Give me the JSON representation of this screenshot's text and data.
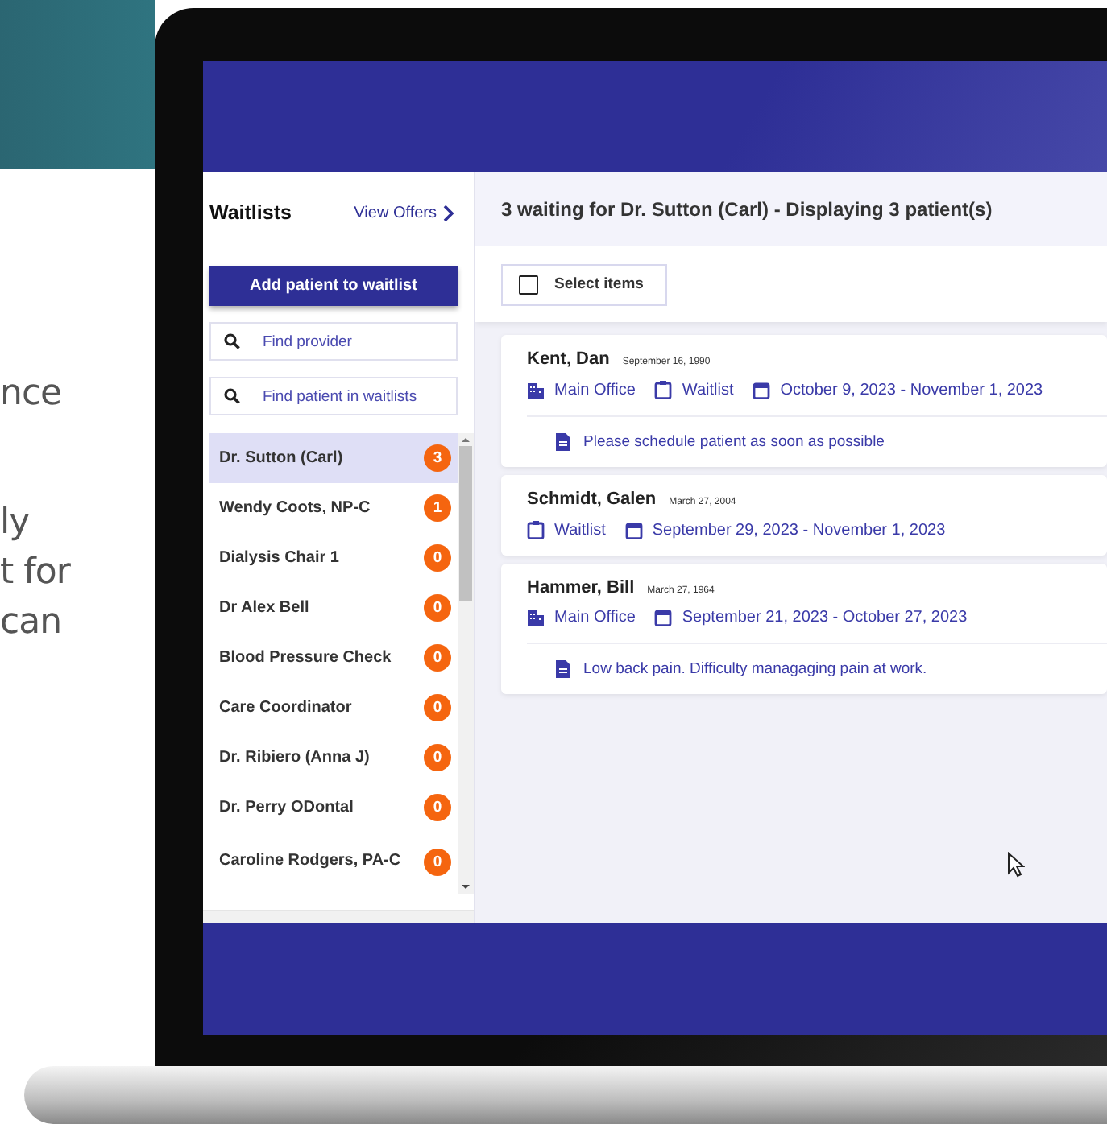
{
  "marketing_text": [
    "nce",
    "ly",
    "t for",
    "can"
  ],
  "sidebar": {
    "title": "Waitlists",
    "link": "View Offers",
    "add_button": "Add patient to waitlist",
    "search_fields": [
      {
        "placeholder": "Find provider"
      },
      {
        "placeholder": "Find patient in waitlists"
      }
    ],
    "providers": [
      {
        "name": "Dr. Sutton (Carl)",
        "count": "3",
        "selected": true
      },
      {
        "name": "Wendy Coots, NP-C",
        "count": "1",
        "selected": false
      },
      {
        "name": "Dialysis Chair 1",
        "count": "0",
        "selected": false
      },
      {
        "name": "Dr Alex Bell",
        "count": "0",
        "selected": false
      },
      {
        "name": "Blood Pressure Check",
        "count": "0",
        "selected": false
      },
      {
        "name": "Care Coordinator",
        "count": "0",
        "selected": false
      },
      {
        "name": "Dr. Ribiero (Anna J)",
        "count": "0",
        "selected": false
      },
      {
        "name": "Dr. Perry ODontal",
        "count": "0",
        "selected": false
      },
      {
        "name": "Caroline Rodgers, PA-C",
        "count": "0",
        "selected": false
      }
    ]
  },
  "main": {
    "header": "3 waiting for Dr. Sutton (Carl) - Displaying 3 patient(s)",
    "select_items": {
      "label": "Select items",
      "checked": false
    },
    "patients": [
      {
        "name": "Kent, Dan",
        "dob": "September 16, 1990",
        "details": [
          {
            "kind": "location",
            "text": "Main Office"
          },
          {
            "kind": "list",
            "text": "Waitlist"
          },
          {
            "kind": "dates",
            "text": "October 9, 2023 - November 1, 2023"
          }
        ],
        "note": "Please schedule patient as soon as possible"
      },
      {
        "name": "Schmidt, Galen",
        "dob": "March 27, 2004",
        "details": [
          {
            "kind": "list",
            "text": "Waitlist"
          },
          {
            "kind": "dates",
            "text": "September 29, 2023 - November 1, 2023"
          }
        ]
      },
      {
        "name": "Hammer, Bill",
        "dob": "March 27, 1964",
        "details": [
          {
            "kind": "location",
            "text": "Main Office"
          },
          {
            "kind": "dates",
            "text": "September 21, 2023 - October 27, 2023"
          }
        ],
        "note": "Low back pain. Difficulty managaging pain at work."
      }
    ]
  }
}
